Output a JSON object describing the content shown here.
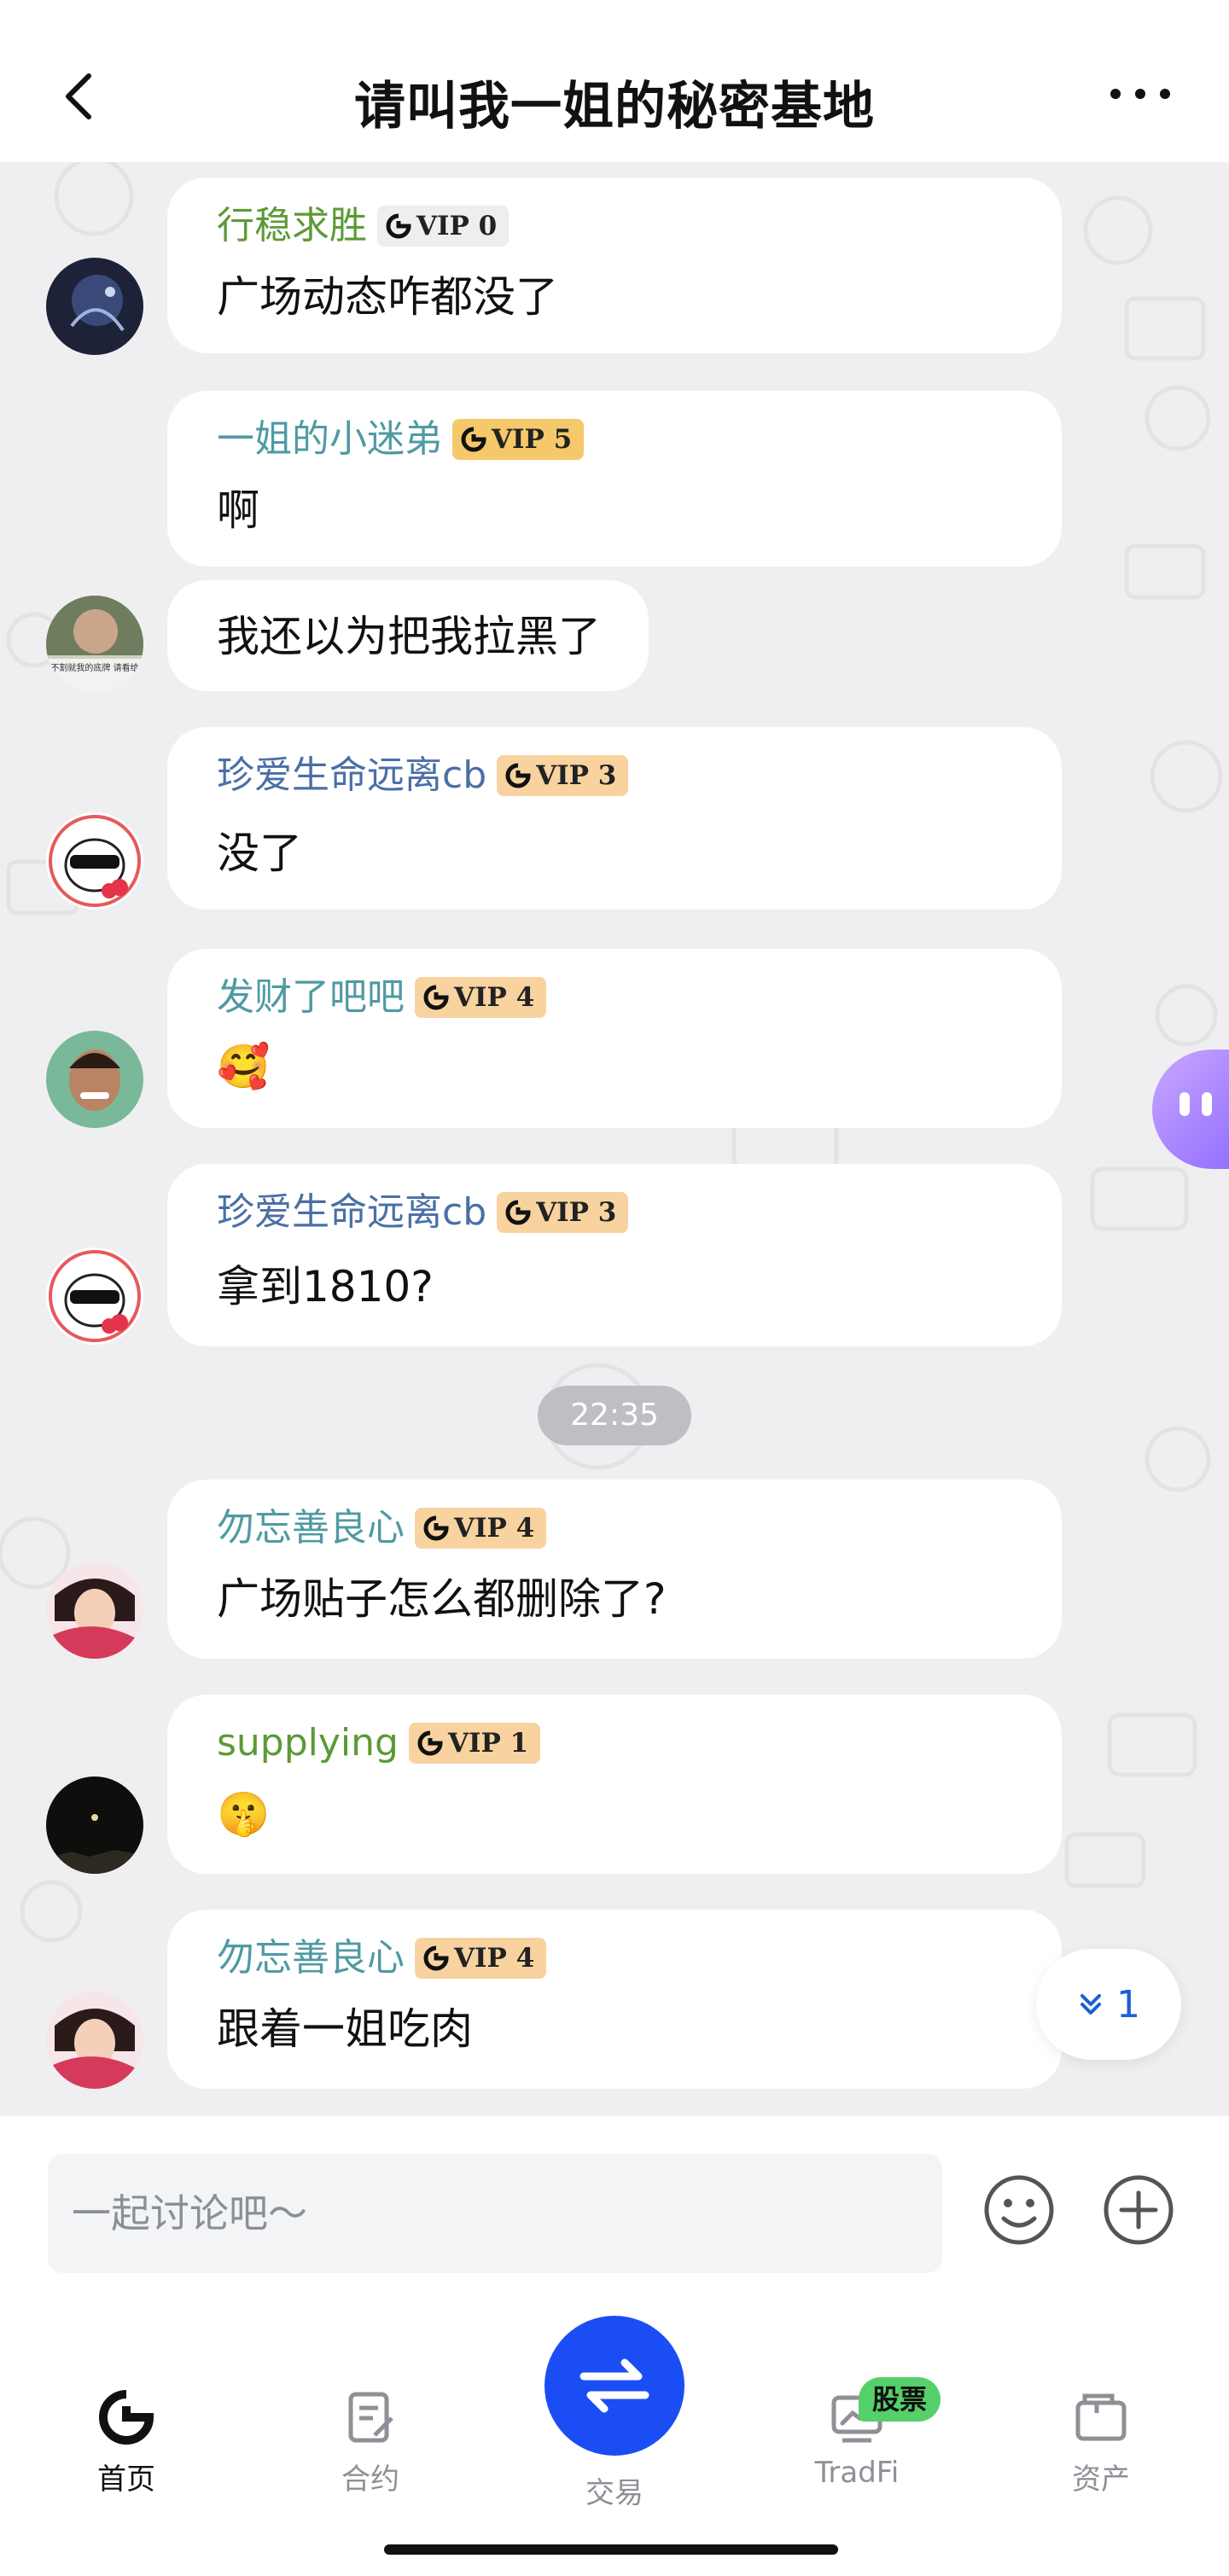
{
  "header": {
    "title": "请叫我一姐的秘密基地"
  },
  "colors": {
    "name_green": "#5b9a35",
    "name_teal": "#4f9aa3",
    "name_blue": "#4a6fa5",
    "vip0_bg": "#eeeeee",
    "vip_bg": "#f8d3a0",
    "vip5_bg": "#f5c86a",
    "primary": "#1b4df5"
  },
  "messages": [
    {
      "sender": "行稳求胜",
      "vip": "VIP 0",
      "text": "广场动态咋都没了"
    },
    {
      "sender": "一姐的小迷弟",
      "vip": "VIP 5",
      "text": "啊"
    },
    {
      "text": "我还以为把我拉黑了"
    },
    {
      "sender": "珍爱生命远离cb",
      "vip": "VIP 3",
      "text": " 没了"
    },
    {
      "sender": "发财了吧吧",
      "vip": "VIP 4",
      "text": "🥰"
    },
    {
      "sender": "珍爱生命远离cb",
      "vip": "VIP 3",
      "text": "拿到1810?"
    },
    {
      "sender": "勿忘善良心",
      "vip": "VIP 4",
      "text": "广场贴子怎么都删除了?"
    },
    {
      "sender": "supplying",
      "vip": "VIP 1",
      "text": "🤫"
    },
    {
      "sender": "勿忘善良心",
      "vip": "VIP 4",
      "text": "跟着一姐吃肉"
    }
  ],
  "timestamp": "22:35",
  "unread": {
    "count": "1"
  },
  "avatar_text": "只要不割就我的底牌 请看给你地",
  "input": {
    "placeholder": "一起讨论吧～"
  },
  "tabs": [
    {
      "label": "首页"
    },
    {
      "label": "合约"
    },
    {
      "label": "交易"
    },
    {
      "label": "TradFi",
      "badge": "股票"
    },
    {
      "label": "资产"
    }
  ]
}
